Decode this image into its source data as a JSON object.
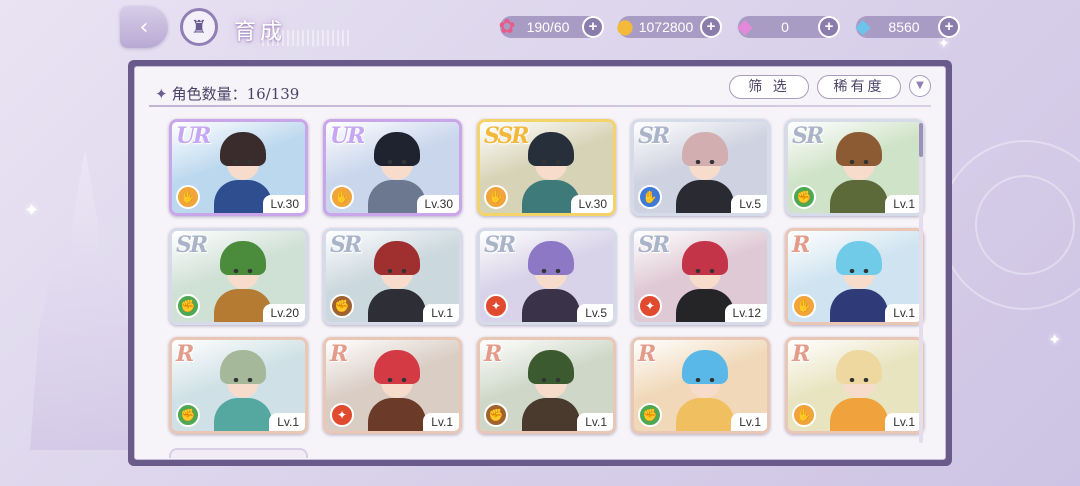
{
  "header": {
    "title": "育成",
    "back_icon": "back-arrow-icon",
    "home_icon": "castle-home-icon"
  },
  "resources": [
    {
      "name": "stamina",
      "icon": "candy-icon",
      "value": "190/60",
      "color": "#e75a8c"
    },
    {
      "name": "gold",
      "icon": "coin-icon",
      "value": "1072800",
      "color": "#f4b93a"
    },
    {
      "name": "pink-gem",
      "icon": "pink-diamond-icon",
      "value": "0",
      "color": "#e28ad9"
    },
    {
      "name": "blue-gem",
      "icon": "blue-diamond-icon",
      "value": "8560",
      "color": "#6cc3ec"
    }
  ],
  "panel": {
    "count_label": "角色数量：16/139",
    "filter_label": "筛 选",
    "sort_label": "稀有度"
  },
  "cards": [
    {
      "rarity": "UR",
      "level": "Lv.30",
      "type_color": "#f0a43a",
      "hair": "#3a2c2c",
      "outfit": "#2f4e8f",
      "bg": "#bcd8ee"
    },
    {
      "rarity": "UR",
      "level": "Lv.30",
      "type_color": "#f0a43a",
      "hair": "#1f2330",
      "outfit": "#6b7890",
      "bg": "#c9d6ec"
    },
    {
      "rarity": "SSR",
      "level": "Lv.30",
      "type_color": "#f0a43a",
      "hair": "#27303a",
      "outfit": "#3e7a7a",
      "bg": "#d7d3b6"
    },
    {
      "rarity": "SR",
      "level": "Lv.5",
      "type_color": "#3f7bd6",
      "hair": "#d2aeb0",
      "outfit": "#2a2a32",
      "bg": "#cfd2e0"
    },
    {
      "rarity": "SR",
      "level": "Lv.1",
      "type_color": "#4ea852",
      "hair": "#8c5a33",
      "outfit": "#5c6a3a",
      "bg": "#cfe3c8"
    },
    {
      "rarity": "SR",
      "level": "Lv.20",
      "type_color": "#4ea852",
      "hair": "#4b8c3c",
      "outfit": "#b57b32",
      "bg": "#cfe0d5"
    },
    {
      "rarity": "SR",
      "level": "Lv.1",
      "type_color": "#a0622e",
      "hair": "#a02f2f",
      "outfit": "#2e2e36",
      "bg": "#cbd8de"
    },
    {
      "rarity": "SR",
      "level": "Lv.5",
      "type_color": "#e04a2e",
      "hair": "#8d78c6",
      "outfit": "#3a3248",
      "bg": "#d8d3e8"
    },
    {
      "rarity": "SR",
      "level": "Lv.12",
      "type_color": "#e04a2e",
      "hair": "#c43448",
      "outfit": "#252528",
      "bg": "#dfc9d4"
    },
    {
      "rarity": "R",
      "level": "Lv.1",
      "type_color": "#f0a43a",
      "hair": "#6fcbe8",
      "outfit": "#2e3b78",
      "bg": "#cfe3f0"
    },
    {
      "rarity": "R",
      "level": "Lv.1",
      "type_color": "#4ea852",
      "hair": "#a6b89a",
      "outfit": "#55a8a0",
      "bg": "#cfe1e6"
    },
    {
      "rarity": "R",
      "level": "Lv.1",
      "type_color": "#e04a2e",
      "hair": "#d43a44",
      "outfit": "#6b3a28",
      "bg": "#dacdc4"
    },
    {
      "rarity": "R",
      "level": "Lv.1",
      "type_color": "#a0622e",
      "hair": "#3c5a30",
      "outfit": "#4a3a2e",
      "bg": "#cfd8c8"
    },
    {
      "rarity": "R",
      "level": "Lv.1",
      "type_color": "#4ea852",
      "hair": "#5ab8e8",
      "outfit": "#f0c060",
      "bg": "#f0d8b8"
    },
    {
      "rarity": "R",
      "level": "Lv.1",
      "type_color": "#f0a43a",
      "hair": "#efd8a0",
      "outfit": "#f0a23c",
      "bg": "#e8e4c0"
    }
  ]
}
